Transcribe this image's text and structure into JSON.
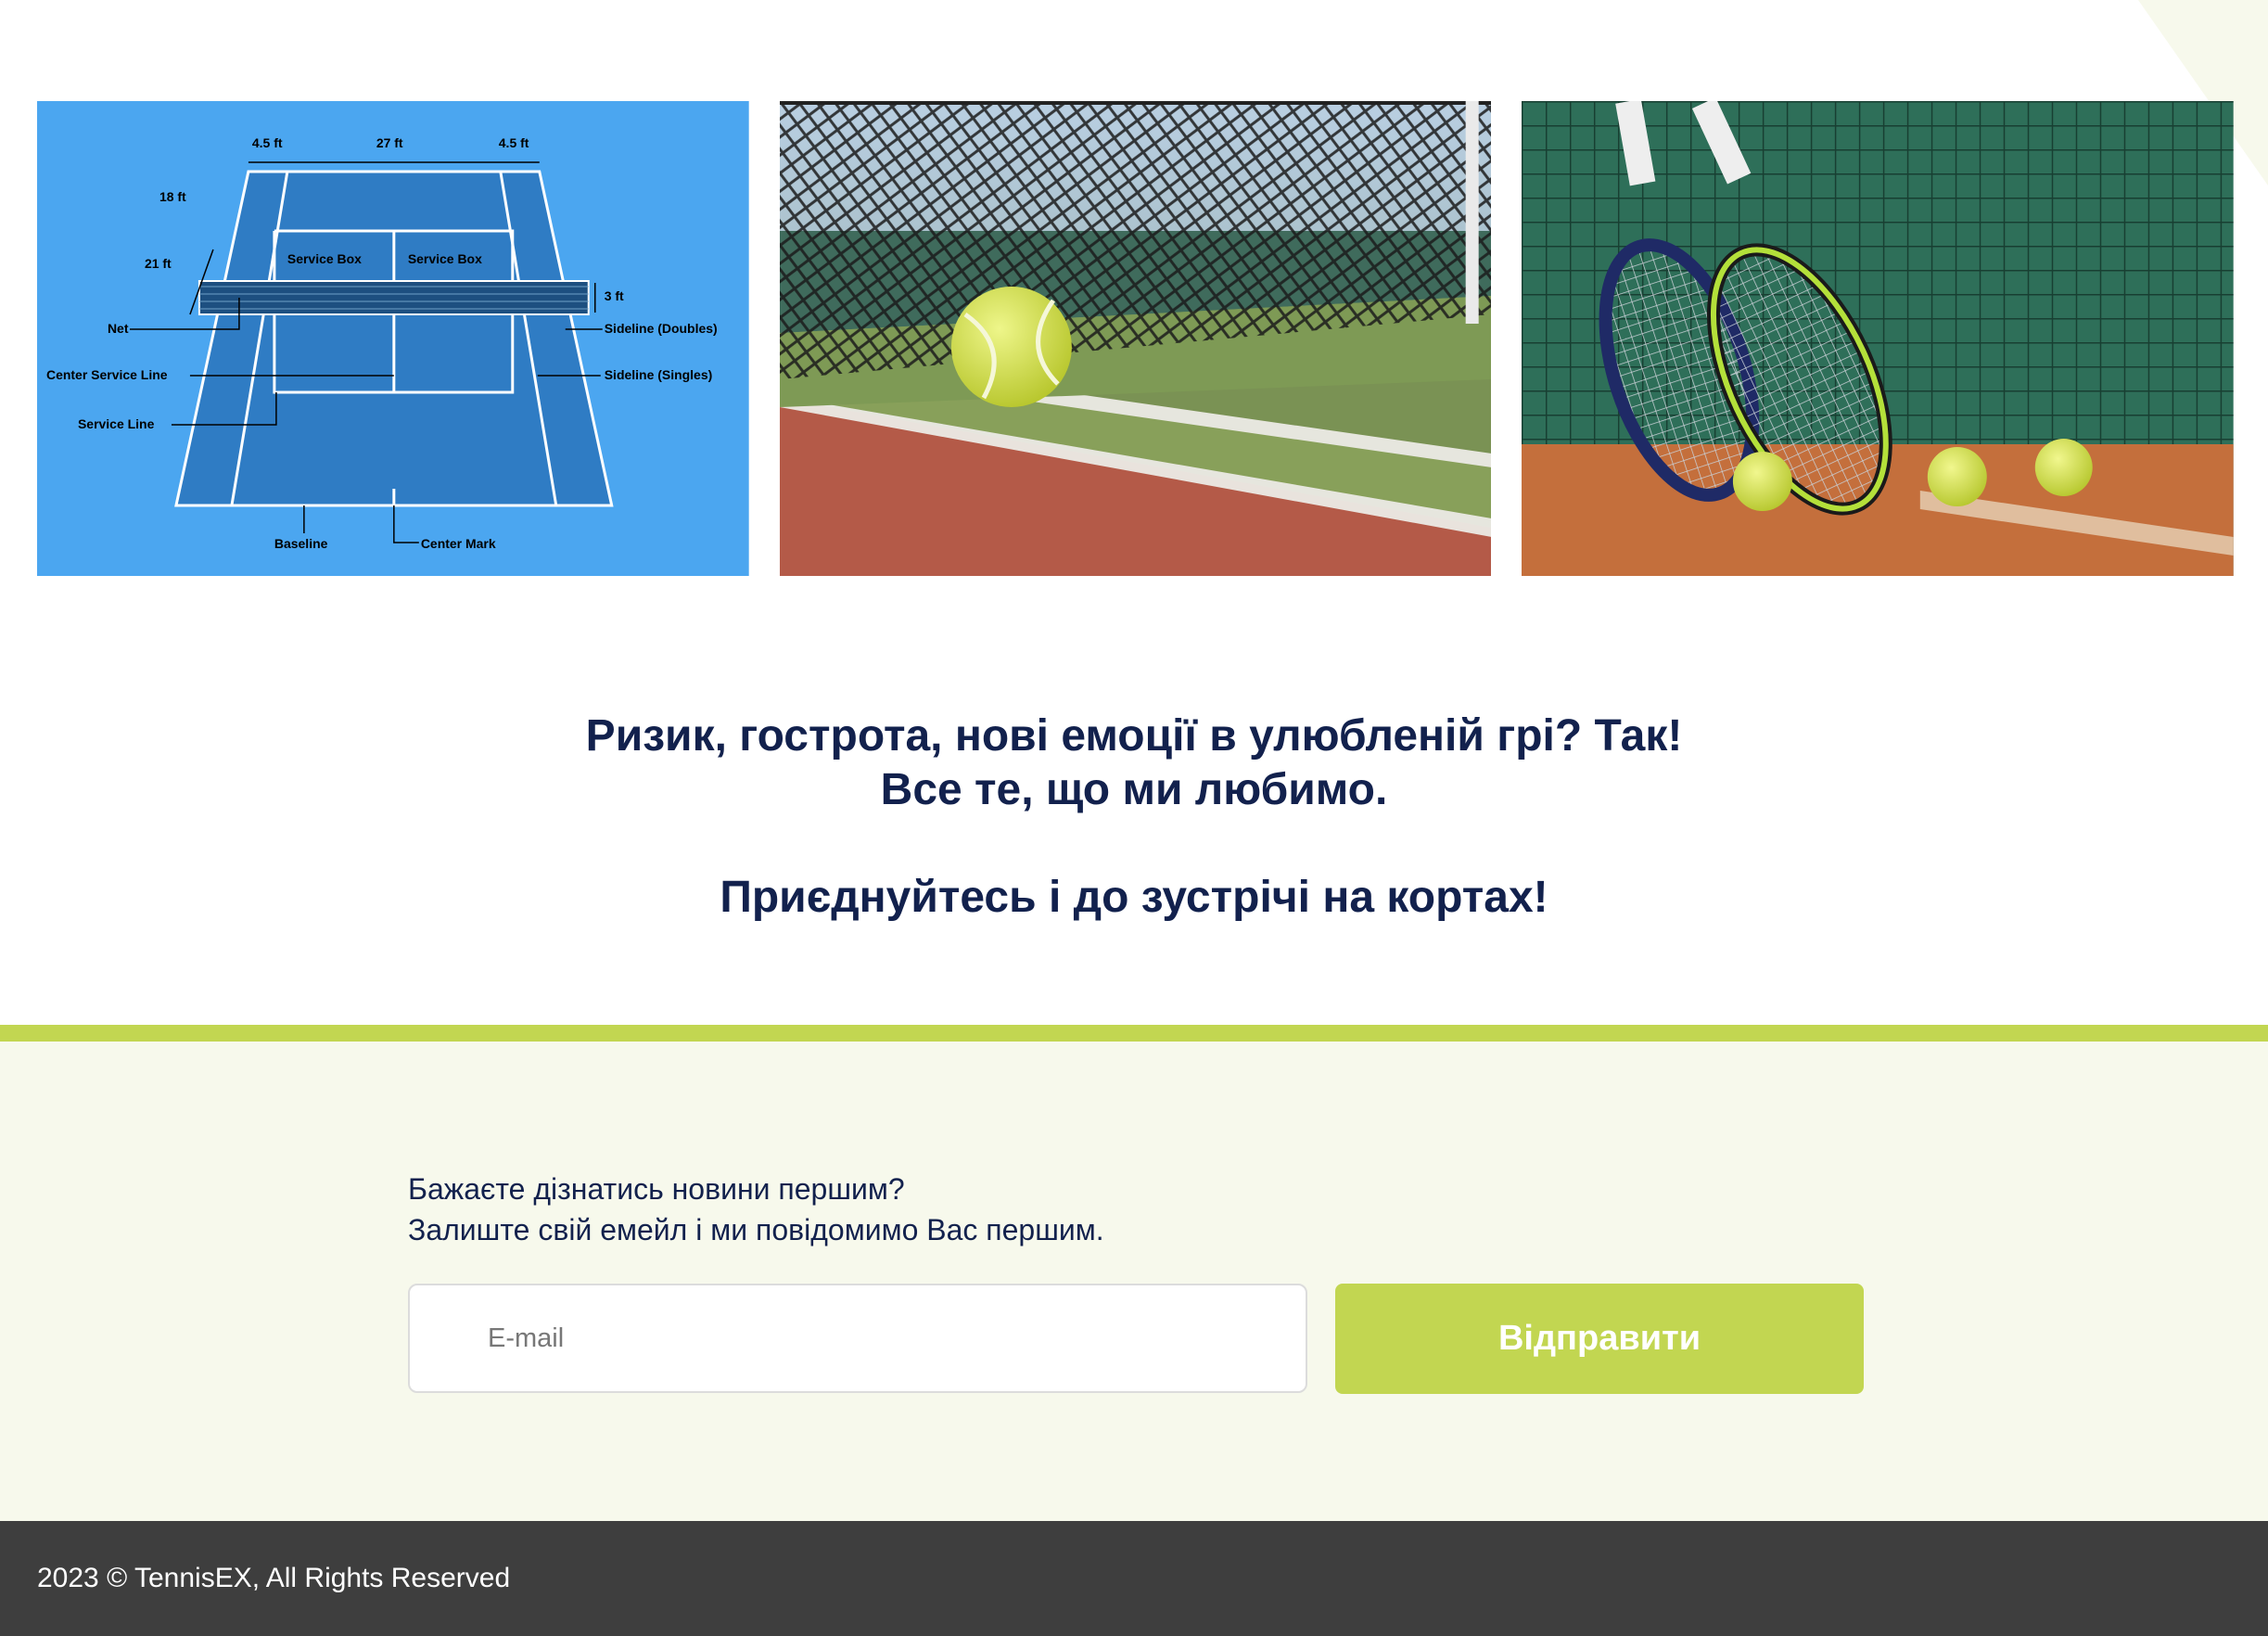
{
  "gallery": {
    "diagram": {
      "alt": "tennis-court-diagram",
      "dims": {
        "left": "4.5 ft",
        "center": "27 ft",
        "right": "4.5 ft",
        "h18": "18 ft",
        "h21": "21 ft",
        "net_h": "3 ft"
      },
      "labels": {
        "service_box_left": "Service Box",
        "service_box_right": "Service Box",
        "net": "Net",
        "center_service_line": "Center Service Line",
        "service_line": "Service Line",
        "baseline": "Baseline",
        "center_mark": "Center Mark",
        "sideline_doubles": "Sideline (Doubles)",
        "sideline_singles": "Sideline (Singles)"
      }
    },
    "photo_net": {
      "alt": "tennis-ball-at-net-photo"
    },
    "photo_rackets": {
      "alt": "rackets-and-balls-photo"
    }
  },
  "headline": {
    "line1": "Ризик, гострота, нові емоції в улюбленій грі? Так!",
    "line2": "Все те, що ми любимо.",
    "line3": "Приєднуйтесь і до зустрічі на кортах!"
  },
  "newsletter": {
    "line1": "Бажаєте дізнатись новини першим?",
    "line2": "Залиште свій емейл і ми повідомимо Вас першим.",
    "email_placeholder": "E-mail",
    "email_value": "",
    "submit_label": "Відправити"
  },
  "footer": {
    "copyright": "2023 © TennisEX, All Rights Reserved"
  },
  "colors": {
    "navy": "#12214d",
    "lime": "#c2d651",
    "cream": "#f7f9ec",
    "footer": "#3e3e3e",
    "court_blue": "#4ba6f0"
  }
}
